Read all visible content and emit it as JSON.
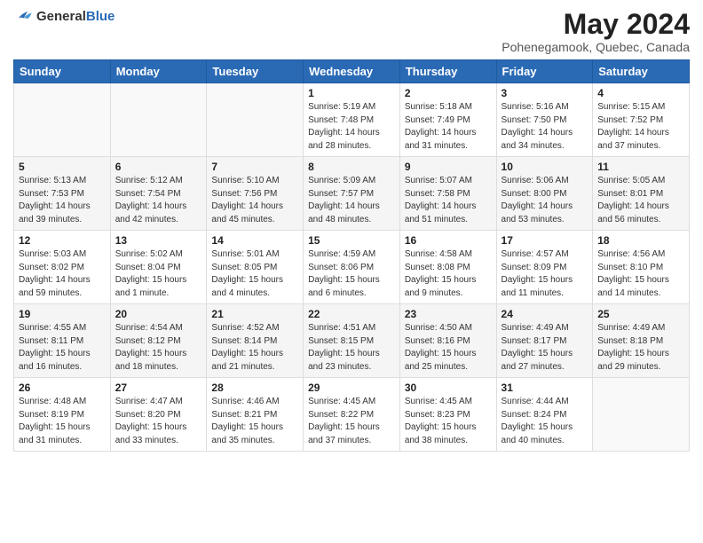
{
  "header": {
    "logo_general": "General",
    "logo_blue": "Blue",
    "title": "May 2024",
    "location": "Pohenegamook, Quebec, Canada"
  },
  "weekdays": [
    "Sunday",
    "Monday",
    "Tuesday",
    "Wednesday",
    "Thursday",
    "Friday",
    "Saturday"
  ],
  "weeks": [
    [
      {
        "day": "",
        "sunrise": "",
        "sunset": "",
        "daylight": ""
      },
      {
        "day": "",
        "sunrise": "",
        "sunset": "",
        "daylight": ""
      },
      {
        "day": "",
        "sunrise": "",
        "sunset": "",
        "daylight": ""
      },
      {
        "day": "1",
        "sunrise": "Sunrise: 5:19 AM",
        "sunset": "Sunset: 7:48 PM",
        "daylight": "Daylight: 14 hours and 28 minutes."
      },
      {
        "day": "2",
        "sunrise": "Sunrise: 5:18 AM",
        "sunset": "Sunset: 7:49 PM",
        "daylight": "Daylight: 14 hours and 31 minutes."
      },
      {
        "day": "3",
        "sunrise": "Sunrise: 5:16 AM",
        "sunset": "Sunset: 7:50 PM",
        "daylight": "Daylight: 14 hours and 34 minutes."
      },
      {
        "day": "4",
        "sunrise": "Sunrise: 5:15 AM",
        "sunset": "Sunset: 7:52 PM",
        "daylight": "Daylight: 14 hours and 37 minutes."
      }
    ],
    [
      {
        "day": "5",
        "sunrise": "Sunrise: 5:13 AM",
        "sunset": "Sunset: 7:53 PM",
        "daylight": "Daylight: 14 hours and 39 minutes."
      },
      {
        "day": "6",
        "sunrise": "Sunrise: 5:12 AM",
        "sunset": "Sunset: 7:54 PM",
        "daylight": "Daylight: 14 hours and 42 minutes."
      },
      {
        "day": "7",
        "sunrise": "Sunrise: 5:10 AM",
        "sunset": "Sunset: 7:56 PM",
        "daylight": "Daylight: 14 hours and 45 minutes."
      },
      {
        "day": "8",
        "sunrise": "Sunrise: 5:09 AM",
        "sunset": "Sunset: 7:57 PM",
        "daylight": "Daylight: 14 hours and 48 minutes."
      },
      {
        "day": "9",
        "sunrise": "Sunrise: 5:07 AM",
        "sunset": "Sunset: 7:58 PM",
        "daylight": "Daylight: 14 hours and 51 minutes."
      },
      {
        "day": "10",
        "sunrise": "Sunrise: 5:06 AM",
        "sunset": "Sunset: 8:00 PM",
        "daylight": "Daylight: 14 hours and 53 minutes."
      },
      {
        "day": "11",
        "sunrise": "Sunrise: 5:05 AM",
        "sunset": "Sunset: 8:01 PM",
        "daylight": "Daylight: 14 hours and 56 minutes."
      }
    ],
    [
      {
        "day": "12",
        "sunrise": "Sunrise: 5:03 AM",
        "sunset": "Sunset: 8:02 PM",
        "daylight": "Daylight: 14 hours and 59 minutes."
      },
      {
        "day": "13",
        "sunrise": "Sunrise: 5:02 AM",
        "sunset": "Sunset: 8:04 PM",
        "daylight": "Daylight: 15 hours and 1 minute."
      },
      {
        "day": "14",
        "sunrise": "Sunrise: 5:01 AM",
        "sunset": "Sunset: 8:05 PM",
        "daylight": "Daylight: 15 hours and 4 minutes."
      },
      {
        "day": "15",
        "sunrise": "Sunrise: 4:59 AM",
        "sunset": "Sunset: 8:06 PM",
        "daylight": "Daylight: 15 hours and 6 minutes."
      },
      {
        "day": "16",
        "sunrise": "Sunrise: 4:58 AM",
        "sunset": "Sunset: 8:08 PM",
        "daylight": "Daylight: 15 hours and 9 minutes."
      },
      {
        "day": "17",
        "sunrise": "Sunrise: 4:57 AM",
        "sunset": "Sunset: 8:09 PM",
        "daylight": "Daylight: 15 hours and 11 minutes."
      },
      {
        "day": "18",
        "sunrise": "Sunrise: 4:56 AM",
        "sunset": "Sunset: 8:10 PM",
        "daylight": "Daylight: 15 hours and 14 minutes."
      }
    ],
    [
      {
        "day": "19",
        "sunrise": "Sunrise: 4:55 AM",
        "sunset": "Sunset: 8:11 PM",
        "daylight": "Daylight: 15 hours and 16 minutes."
      },
      {
        "day": "20",
        "sunrise": "Sunrise: 4:54 AM",
        "sunset": "Sunset: 8:12 PM",
        "daylight": "Daylight: 15 hours and 18 minutes."
      },
      {
        "day": "21",
        "sunrise": "Sunrise: 4:52 AM",
        "sunset": "Sunset: 8:14 PM",
        "daylight": "Daylight: 15 hours and 21 minutes."
      },
      {
        "day": "22",
        "sunrise": "Sunrise: 4:51 AM",
        "sunset": "Sunset: 8:15 PM",
        "daylight": "Daylight: 15 hours and 23 minutes."
      },
      {
        "day": "23",
        "sunrise": "Sunrise: 4:50 AM",
        "sunset": "Sunset: 8:16 PM",
        "daylight": "Daylight: 15 hours and 25 minutes."
      },
      {
        "day": "24",
        "sunrise": "Sunrise: 4:49 AM",
        "sunset": "Sunset: 8:17 PM",
        "daylight": "Daylight: 15 hours and 27 minutes."
      },
      {
        "day": "25",
        "sunrise": "Sunrise: 4:49 AM",
        "sunset": "Sunset: 8:18 PM",
        "daylight": "Daylight: 15 hours and 29 minutes."
      }
    ],
    [
      {
        "day": "26",
        "sunrise": "Sunrise: 4:48 AM",
        "sunset": "Sunset: 8:19 PM",
        "daylight": "Daylight: 15 hours and 31 minutes."
      },
      {
        "day": "27",
        "sunrise": "Sunrise: 4:47 AM",
        "sunset": "Sunset: 8:20 PM",
        "daylight": "Daylight: 15 hours and 33 minutes."
      },
      {
        "day": "28",
        "sunrise": "Sunrise: 4:46 AM",
        "sunset": "Sunset: 8:21 PM",
        "daylight": "Daylight: 15 hours and 35 minutes."
      },
      {
        "day": "29",
        "sunrise": "Sunrise: 4:45 AM",
        "sunset": "Sunset: 8:22 PM",
        "daylight": "Daylight: 15 hours and 37 minutes."
      },
      {
        "day": "30",
        "sunrise": "Sunrise: 4:45 AM",
        "sunset": "Sunset: 8:23 PM",
        "daylight": "Daylight: 15 hours and 38 minutes."
      },
      {
        "day": "31",
        "sunrise": "Sunrise: 4:44 AM",
        "sunset": "Sunset: 8:24 PM",
        "daylight": "Daylight: 15 hours and 40 minutes."
      },
      {
        "day": "",
        "sunrise": "",
        "sunset": "",
        "daylight": ""
      }
    ]
  ]
}
